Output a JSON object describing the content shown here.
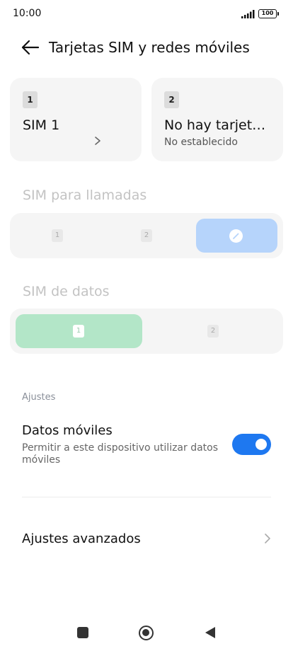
{
  "status_bar": {
    "time": "10:00",
    "battery": "100"
  },
  "header": {
    "title": "Tarjetas SIM y redes móviles"
  },
  "sim_cards": [
    {
      "slot": "1",
      "name": "SIM 1",
      "status": ""
    },
    {
      "slot": "2",
      "name": "No hay tarjeta SIM",
      "status": "No establecido"
    }
  ],
  "call_sim": {
    "title": "SIM para llamadas",
    "options": [
      "1",
      "2"
    ],
    "selected": "edit-ask"
  },
  "data_sim": {
    "title": "SIM de datos",
    "options": [
      "1",
      "2"
    ],
    "selected": "1"
  },
  "settings": {
    "group_label": "Ajustes",
    "mobile_data": {
      "title": "Datos móviles",
      "description": "Permitir a este dispositivo utilizar datos móviles",
      "enabled": true
    },
    "advanced": {
      "title": "Ajustes avanzados"
    }
  },
  "colors": {
    "accent": "#1e78f0",
    "call_selected": "#b6d4fb",
    "data_selected": "#b3e6c8",
    "card_bg": "#f5f5f5"
  }
}
